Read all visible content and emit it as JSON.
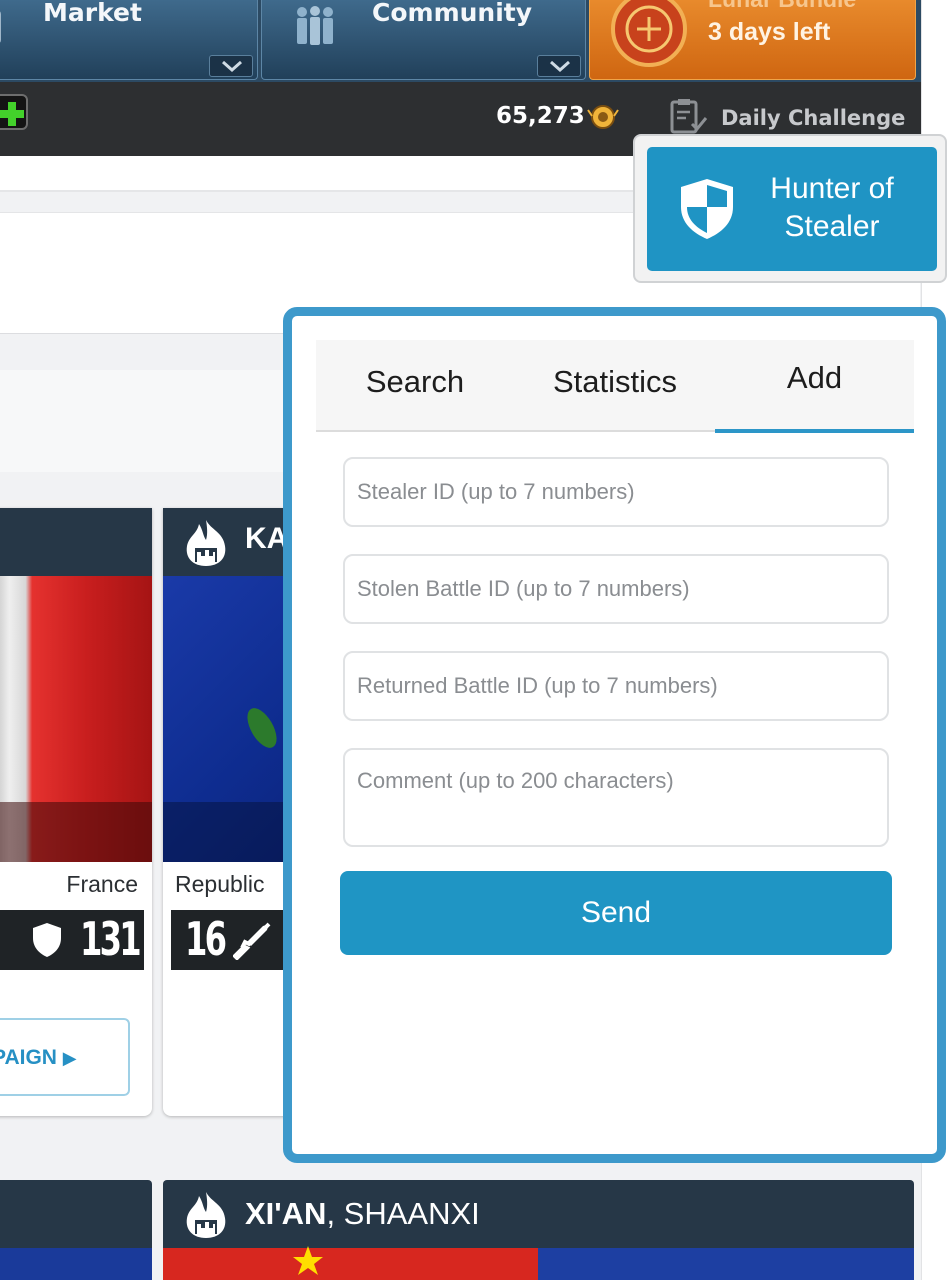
{
  "nav": {
    "market_label": "Market",
    "community_label": "Community",
    "lunar_title": "Lunar Bundle",
    "lunar_days": "3 days left"
  },
  "status": {
    "coins": "65,273",
    "daily_challenge": "Daily Challenge"
  },
  "cards": [
    {
      "country": "France",
      "stat": "131",
      "campaign_label": "PAIGN"
    },
    {
      "name": "KA",
      "country": "Republic",
      "stat": "16"
    }
  ],
  "bottom_card": {
    "city": "XI'AN",
    "region": ", SHAANXI"
  },
  "hunter": {
    "label_line1": "Hunter of",
    "label_line2": "Stealer"
  },
  "popup": {
    "tabs": {
      "search": "Search",
      "statistics": "Statistics",
      "add": "Add"
    },
    "active_tab": "Add",
    "fields": {
      "stealer_id_placeholder": "Stealer ID (up to 7 numbers)",
      "stolen_battle_placeholder": "Stolen Battle ID (up to 7 numbers)",
      "returned_battle_placeholder": "Returned Battle ID (up to 7 numbers)",
      "comment_placeholder": "Comment (up to 200 characters)"
    },
    "send_label": "Send"
  },
  "colors": {
    "accent": "#1f95c4",
    "popup_border": "#3d99cb",
    "nav_blue": "#2c4a63",
    "lunar_orange": "#e07a22"
  },
  "icons": [
    "people-icon",
    "lunar-bundle-icon",
    "plus-icon",
    "coin-icon",
    "clipboard-icon",
    "shield-icon",
    "sword-icon",
    "fire-icon",
    "chevron-down-icon"
  ]
}
